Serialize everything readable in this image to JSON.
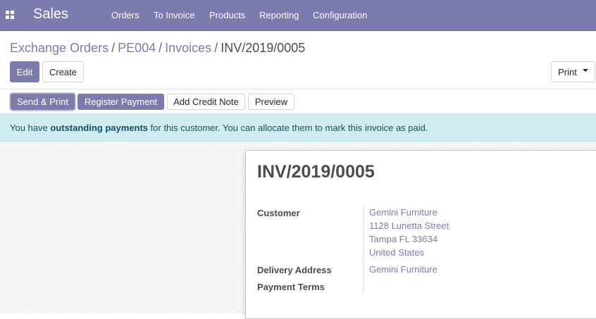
{
  "navbar": {
    "app_name": "Sales",
    "menu": [
      "Orders",
      "To Invoice",
      "Products",
      "Reporting",
      "Configuration"
    ],
    "accent_color": "#7c7bad"
  },
  "breadcrumb": {
    "items": [
      "Exchange Orders",
      "PE004",
      "Invoices"
    ],
    "current": "INV/2019/0005",
    "separator": "/"
  },
  "control_panel": {
    "edit_label": "Edit",
    "create_label": "Create",
    "print_label": "Print"
  },
  "statusbar": {
    "send_print_label": "Send & Print",
    "register_payment_label": "Register Payment",
    "add_credit_note_label": "Add Credit Note",
    "preview_label": "Preview"
  },
  "alert": {
    "prefix": "You have ",
    "bold": "outstanding payments",
    "suffix": " for this customer. You can allocate them to mark this invoice as paid."
  },
  "invoice": {
    "title": "INV/2019/0005",
    "customer_label": "Customer",
    "customer_lines": [
      "Gemini Furniture",
      "1128 Lunetta Street",
      "Tampa FL 33634",
      "United States"
    ],
    "delivery_address_label": "Delivery Address",
    "delivery_address_value": "Gemini Furniture",
    "payment_terms_label": "Payment Terms",
    "payment_terms_value": ""
  }
}
